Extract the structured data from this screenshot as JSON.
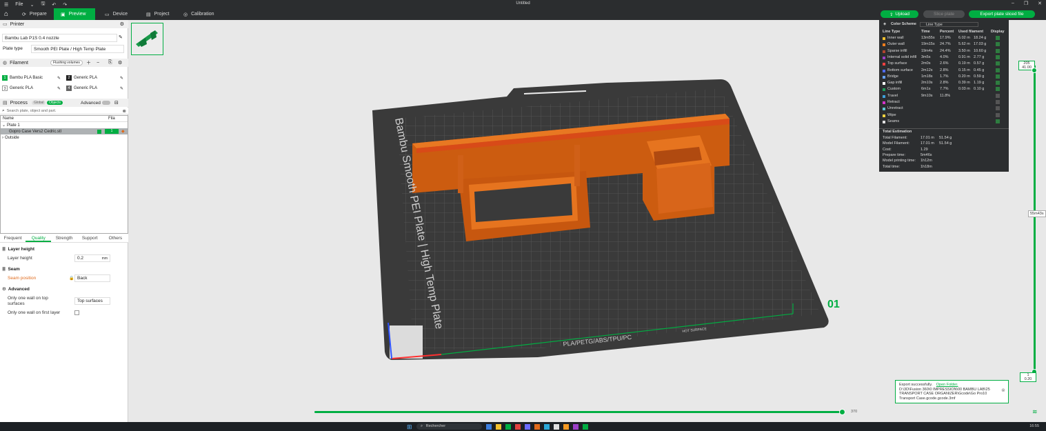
{
  "app": {
    "title": "Untitled",
    "file_menu": "File"
  },
  "tabs": [
    {
      "label": "Prepare"
    },
    {
      "label": "Preview"
    },
    {
      "label": "Device"
    },
    {
      "label": "Project"
    },
    {
      "label": "Calibration"
    }
  ],
  "actions": {
    "upload": "Upload",
    "slice": "Slice plate",
    "export": "Export plate sliced file"
  },
  "printer": {
    "header": "Printer",
    "model": "Bambu Lab P1S 0.4 nozzle",
    "plate_label": "Plate type",
    "plate_value": "Smooth PEI Plate / High Temp Plate"
  },
  "filament": {
    "header": "Filament",
    "flush_button": "Flushing volumes",
    "slots": [
      {
        "num": "1",
        "name": "Bambu PLA Basic",
        "color": "#00ae42"
      },
      {
        "num": "2",
        "name": "Generic PLA",
        "color": "#222222"
      },
      {
        "num": "3",
        "name": "Generic PLA",
        "color": "#ffffff"
      },
      {
        "num": "4",
        "name": "Generic PLA",
        "color": "#666666"
      }
    ]
  },
  "process": {
    "header": "Process",
    "global": "Global",
    "objects": "Objects",
    "advanced": "Advanced",
    "search_placeholder": "Search plate, object and part."
  },
  "objects": {
    "col_name": "Name",
    "col_fila": "Fila",
    "rows": [
      {
        "name": "Plate 1"
      },
      {
        "name": "Gopro Case Vers2 Cedric.stl",
        "fila": "1"
      },
      {
        "name": "Outside"
      }
    ]
  },
  "settings_tabs": [
    "Frequent",
    "Quality",
    "Strength",
    "Support",
    "Others"
  ],
  "quality": {
    "layer_group": "Layer height",
    "layer_label": "Layer height",
    "layer_value": "0.2",
    "layer_unit": "mm",
    "seam_group": "Seam",
    "seam_label": "Seam position",
    "seam_value": "Back",
    "adv_group": "Advanced",
    "top_label_1": "Only one wall on top",
    "top_label_2": "surfaces",
    "top_value": "Top surfaces",
    "first_layer_label": "Only one wall on first layer"
  },
  "legend": {
    "title": "Color Scheme",
    "scheme": "Line Type",
    "headers": [
      "Line Type",
      "Time",
      "Percent",
      "Used filament",
      "Display"
    ],
    "rows": [
      {
        "name": "Inner wall",
        "time": "13m55s",
        "pct": "17.9%",
        "len": "6.02 m",
        "wt": "18.24 g",
        "color": "#f2c12e",
        "shown": true
      },
      {
        "name": "Outer wall",
        "time": "19m15s",
        "pct": "24.7%",
        "len": "5.62 m",
        "wt": "17.03 g",
        "color": "#ff7f1c",
        "shown": true
      },
      {
        "name": "Sparse infill",
        "time": "19m4s",
        "pct": "24.4%",
        "len": "3.50 m",
        "wt": "10.60 g",
        "color": "#b0442f",
        "shown": true
      },
      {
        "name": "Internal solid infill",
        "time": "3m5s",
        "pct": "4.0%",
        "len": "0.91 m",
        "wt": "2.77 g",
        "color": "#9b3fc7",
        "shown": true
      },
      {
        "name": "Top surface",
        "time": "2m0s",
        "pct": "2.6%",
        "len": "0.19 m",
        "wt": "0.57 g",
        "color": "#ff4040",
        "shown": true
      },
      {
        "name": "Bottom surface",
        "time": "2m12s",
        "pct": "2.8%",
        "len": "0.15 m",
        "wt": "0.45 g",
        "color": "#4f6bff",
        "shown": true
      },
      {
        "name": "Bridge",
        "time": "1m18s",
        "pct": "1.7%",
        "len": "0.20 m",
        "wt": "0.59 g",
        "color": "#66a3ff",
        "shown": true
      },
      {
        "name": "Gap infill",
        "time": "2m10s",
        "pct": "2.8%",
        "len": "0.39 m",
        "wt": "1.19 g",
        "color": "#ffffff",
        "shown": true
      },
      {
        "name": "Custom",
        "time": "6m1s",
        "pct": "7.7%",
        "len": "0.03 m",
        "wt": "0.10 g",
        "color": "#1e9e5a",
        "shown": true
      },
      {
        "name": "Travel",
        "time": "9m10s",
        "pct": "11.8%",
        "len": "",
        "wt": "",
        "color": "#3ea0d9",
        "shown": false
      },
      {
        "name": "Retract",
        "time": "",
        "pct": "",
        "len": "",
        "wt": "",
        "color": "#d633c9",
        "shown": false
      },
      {
        "name": "Unretract",
        "time": "",
        "pct": "",
        "len": "",
        "wt": "",
        "color": "#5fc6d1",
        "shown": false
      },
      {
        "name": "Wipe",
        "time": "",
        "pct": "",
        "len": "",
        "wt": "",
        "color": "#f0d240",
        "shown": false
      },
      {
        "name": "Seams",
        "time": "",
        "pct": "",
        "len": "",
        "wt": "",
        "color": "#e0e0e0",
        "shown": true
      }
    ],
    "total_title": "Total Estimation",
    "totals": [
      {
        "label": "Total Filament:",
        "a": "17.01 m",
        "b": "51.54 g"
      },
      {
        "label": "Model Filament:",
        "a": "17.01 m",
        "b": "51.54 g"
      },
      {
        "label": "Cost:",
        "a": "1.29",
        "b": ""
      },
      {
        "label": "Prepare time:",
        "a": "5m46s",
        "b": ""
      },
      {
        "label": "Model printing time:",
        "a": "1h12m",
        "b": ""
      },
      {
        "label": "Total time:",
        "a": "1h18m",
        "b": ""
      }
    ]
  },
  "layer_slider": {
    "top_layer": "205",
    "top_height": "41.00",
    "time_label": "55m43s",
    "bottom_layer": "1",
    "bottom_height": "0.20"
  },
  "move_slider": {
    "value": "370"
  },
  "notification": {
    "message": "Export successfully.",
    "link": "Open Folder.",
    "path1": "D:\\3D\\Fusion 360\\0 IMPRESSION\\00 BAMBU LAB\\25",
    "path2": "TRANSPORT CASE ORGANIZER\\Gcode\\Go Pro10",
    "path3": "Transport Case.gcode.gcode.3mf"
  },
  "plate_text": {
    "side": "Bambu Smooth PEI Plate | High Temp Plate",
    "number": "01",
    "front": "PLA/PETG/ABS/TPU/PC",
    "hot": "HOT SURFACE"
  },
  "taskbar": {
    "search": "Rechercher",
    "time": "16:55"
  }
}
